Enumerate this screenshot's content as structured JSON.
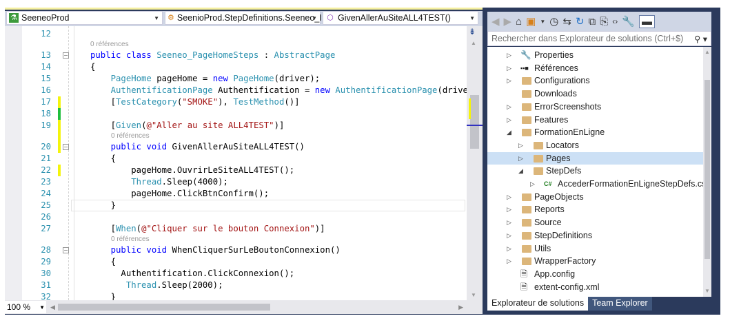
{
  "navbar": {
    "project": "SeeneoProd",
    "class": "SeenioProd.StepDefinitions.Seeneo_I",
    "member": "GivenAllerAuSiteALL4TEST()"
  },
  "editor": {
    "zoom": "100 %",
    "refs_label": "0 références",
    "lines": [
      {
        "n": "12",
        "t": []
      },
      {
        "refs": true,
        "indent": 0
      },
      {
        "n": "13",
        "fold": true,
        "t": [
          [
            "kw",
            "public class "
          ],
          [
            "ty",
            "Seeneo_PageHomeSteps"
          ],
          [
            "pl",
            " : "
          ],
          [
            "ty",
            "AbstractPage"
          ]
        ]
      },
      {
        "n": "14",
        "t": [
          [
            "pl",
            "{"
          ]
        ]
      },
      {
        "n": "15",
        "t": [
          [
            "ty",
            "    PageHome"
          ],
          [
            "pl",
            " pageHome = "
          ],
          [
            "kw",
            "new "
          ],
          [
            "ty",
            "PageHome"
          ],
          [
            "pl",
            "(driver);"
          ]
        ]
      },
      {
        "n": "16",
        "t": [
          [
            "ty",
            "    AuthentificationPage"
          ],
          [
            "pl",
            " Authentification = "
          ],
          [
            "kw",
            "new "
          ],
          [
            "ty",
            "AuthentificationPage"
          ],
          [
            "pl",
            "(driver);"
          ]
        ]
      },
      {
        "n": "17",
        "m": "#f4f40c",
        "t": [
          [
            "pl",
            "    ["
          ],
          [
            "ty",
            "TestCategory"
          ],
          [
            "pl",
            "("
          ],
          [
            "st",
            "\"SMOKE\""
          ],
          [
            "pl",
            "), "
          ],
          [
            "ty",
            "TestMethod"
          ],
          [
            "pl",
            "()]"
          ]
        ]
      },
      {
        "n": "18",
        "m": "#1fbe3c",
        "t": []
      },
      {
        "n": "19",
        "m": "#f4f40c",
        "t": [
          [
            "pl",
            "    ["
          ],
          [
            "ty",
            "Given"
          ],
          [
            "pl",
            "("
          ],
          [
            "st",
            "@\"Aller au site ALL4TEST\""
          ],
          [
            "pl",
            ")]"
          ]
        ]
      },
      {
        "refs": true,
        "indent": 1,
        "m": "#f4f40c"
      },
      {
        "n": "20",
        "m": "#f4f40c",
        "fold": true,
        "t": [
          [
            "kw",
            "    public void "
          ],
          [
            "pl",
            "GivenAllerAuSiteALL4TEST()"
          ]
        ]
      },
      {
        "n": "21",
        "t": [
          [
            "pl",
            "    {"
          ]
        ]
      },
      {
        "n": "22",
        "m": "#f4f40c",
        "t": [
          [
            "pl",
            "        pageHome.OuvrirLeSiteALL4TEST();"
          ]
        ]
      },
      {
        "n": "23",
        "t": [
          [
            "ty",
            "        Thread"
          ],
          [
            "pl",
            ".Sleep(4000);"
          ]
        ]
      },
      {
        "n": "24",
        "t": [
          [
            "pl",
            "        pageHome.ClickBtnConfirm();"
          ]
        ]
      },
      {
        "n": "25",
        "cur": true,
        "t": [
          [
            "pl",
            "    }"
          ]
        ]
      },
      {
        "n": "26",
        "t": []
      },
      {
        "n": "27",
        "t": [
          [
            "pl",
            "    ["
          ],
          [
            "ty",
            "When"
          ],
          [
            "pl",
            "("
          ],
          [
            "st",
            "@\"Cliquer sur le bouton Connexion\""
          ],
          [
            "pl",
            ")]"
          ]
        ]
      },
      {
        "refs": true,
        "indent": 1
      },
      {
        "n": "28",
        "fold": true,
        "t": [
          [
            "kw",
            "    public void "
          ],
          [
            "pl",
            "WhenCliquerSurLeBoutonConnexion()"
          ]
        ]
      },
      {
        "n": "29",
        "t": [
          [
            "pl",
            "    {"
          ]
        ]
      },
      {
        "n": "30",
        "t": [
          [
            "pl",
            "      Authentification.ClickConnexion();"
          ]
        ]
      },
      {
        "n": "31",
        "t": [
          [
            "ty",
            "       Thread"
          ],
          [
            "pl",
            ".Sleep(2000);"
          ]
        ]
      },
      {
        "n": "32",
        "t": [
          [
            "pl",
            "    }"
          ]
        ]
      }
    ]
  },
  "solution_explorer": {
    "search_placeholder": "Rechercher dans Explorateur de solutions (Ctrl+$)",
    "items": [
      {
        "label": "Properties",
        "level": 0,
        "exp": "▷",
        "icon": "wrench"
      },
      {
        "label": "Références",
        "level": 0,
        "exp": "▷",
        "icon": "references"
      },
      {
        "label": "Configurations",
        "level": 0,
        "exp": "▷",
        "icon": "folder"
      },
      {
        "label": "Downloads",
        "level": 0,
        "exp": "",
        "icon": "folder"
      },
      {
        "label": "ErrorScreenshots",
        "level": 0,
        "exp": "▷",
        "icon": "folder"
      },
      {
        "label": "Features",
        "level": 0,
        "exp": "▷",
        "icon": "folder"
      },
      {
        "label": "FormationEnLigne",
        "level": 0,
        "exp": "◢",
        "icon": "folder-open"
      },
      {
        "label": "Locators",
        "level": 1,
        "exp": "▷",
        "icon": "folder"
      },
      {
        "label": "Pages",
        "level": 1,
        "exp": "▷",
        "icon": "folder",
        "selected": true
      },
      {
        "label": "StepDefs",
        "level": 1,
        "exp": "◢",
        "icon": "folder-open"
      },
      {
        "label": "AccederFormationEnLigneStepDefs.cs",
        "level": 2,
        "exp": "▷",
        "icon": "csharp"
      },
      {
        "label": "PageObjects",
        "level": 0,
        "exp": "▷",
        "icon": "folder"
      },
      {
        "label": "Reports",
        "level": 0,
        "exp": "▷",
        "icon": "folder"
      },
      {
        "label": "Source",
        "level": 0,
        "exp": "▷",
        "icon": "folder"
      },
      {
        "label": "StepDefinitions",
        "level": 0,
        "exp": "▷",
        "icon": "folder"
      },
      {
        "label": "Utils",
        "level": 0,
        "exp": "▷",
        "icon": "folder"
      },
      {
        "label": "WrapperFactory",
        "level": 0,
        "exp": "▷",
        "icon": "folder"
      },
      {
        "label": "App.config",
        "level": 0,
        "exp": "",
        "icon": "config-file"
      },
      {
        "label": "extent-config.xml",
        "level": 0,
        "exp": "",
        "icon": "xml-file"
      }
    ],
    "tabs": [
      "Explorateur de solutions",
      "Team Explorer"
    ]
  }
}
